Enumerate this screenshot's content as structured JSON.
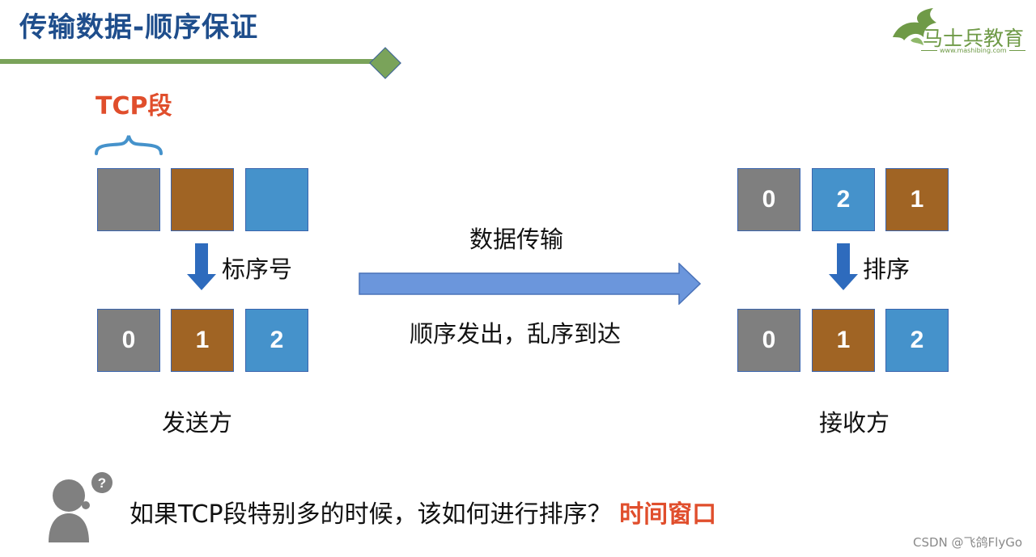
{
  "slide": {
    "title": "传输数据-顺序保证",
    "logo": {
      "name": "马士兵教育",
      "url": "www.mashibing.com",
      "color": "#6f9a47"
    },
    "tcp_segment_label": "TCP段",
    "sender": {
      "label": "发送方",
      "step_label": "标序号",
      "unnumbered_segments": [
        {
          "color": "#7f7f7f"
        },
        {
          "color": "#a06424"
        },
        {
          "color": "#4592cb"
        }
      ],
      "numbered_segments": [
        {
          "number": "0",
          "color": "#7f7f7f"
        },
        {
          "number": "1",
          "color": "#a06424"
        },
        {
          "number": "2",
          "color": "#4592cb"
        }
      ]
    },
    "transfer": {
      "top_label": "数据传输",
      "bottom_label": "顺序发出，乱序到达"
    },
    "receiver": {
      "label": "接收方",
      "step_label": "排序",
      "arrived_segments": [
        {
          "number": "0",
          "color": "#7f7f7f"
        },
        {
          "number": "2",
          "color": "#4592cb"
        },
        {
          "number": "1",
          "color": "#a06424"
        }
      ],
      "sorted_segments": [
        {
          "number": "0",
          "color": "#7f7f7f"
        },
        {
          "number": "1",
          "color": "#a06424"
        },
        {
          "number": "2",
          "color": "#4592cb"
        }
      ]
    },
    "question": {
      "text": "如果TCP段特别多的时候，该如何进行排序？",
      "answer": "时间窗口"
    },
    "watermark": "CSDN @飞鸽FlyGo",
    "colors": {
      "title": "#1f4e8c",
      "accent_red": "#e04e2c",
      "line_green": "#7aa35a",
      "arrow_blue": "#2e6bbd"
    }
  }
}
